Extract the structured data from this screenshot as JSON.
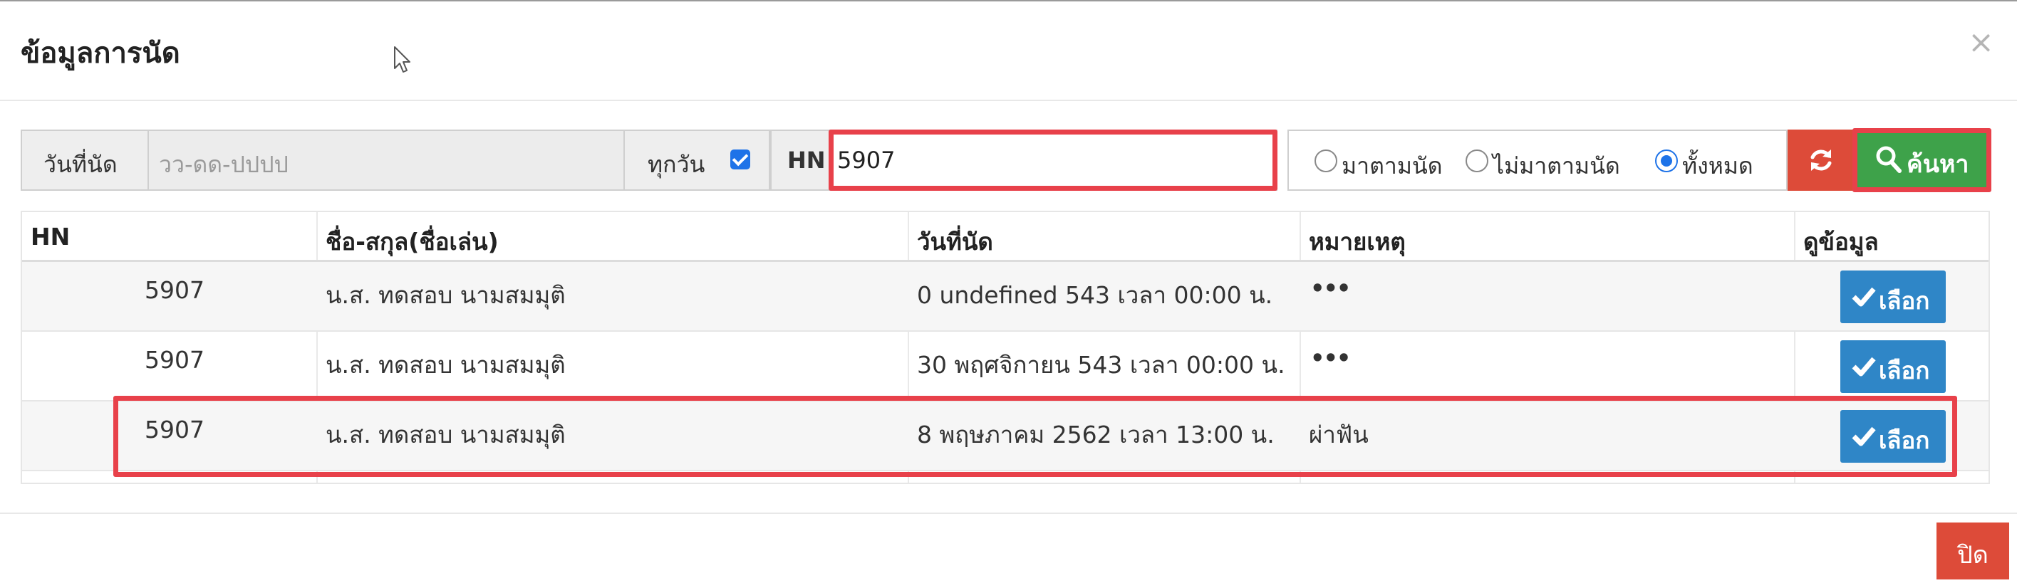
{
  "modal": {
    "title": "ข้อมูลการนัด",
    "close_symbol": "×"
  },
  "search": {
    "date_label": "วันที่นัด",
    "date_placeholder": "วว-ดด-ปปปป",
    "every_day_label": "ทุกวัน",
    "every_day_checked": true,
    "hn_label": "HN",
    "hn_value": "5907",
    "radio_options": [
      {
        "label": "มาตามนัด",
        "selected": false
      },
      {
        "label": "ไม่มาตามนัด",
        "selected": false
      },
      {
        "label": "ทั้งหมด",
        "selected": true
      }
    ],
    "refresh_icon": "refresh-icon",
    "search_button_label": "ค้นหา"
  },
  "table": {
    "headers": [
      "HN",
      "ชื่อ-สกุล(ชื่อเล่น)",
      "วันที่นัด",
      "หมายเหตุ",
      "ดูข้อมูล"
    ],
    "rows": [
      {
        "hn": "5907",
        "name": "น.ส. ทดสอบ นามสมมุติ",
        "date": "0 undefined 543 เวลา 00:00 น.",
        "note": "•••",
        "action": "เลือก"
      },
      {
        "hn": "5907",
        "name": "น.ส. ทดสอบ นามสมมุติ",
        "date": "30 พฤศจิกายน 543 เวลา 00:00 น.",
        "note": "•••",
        "action": "เลือก"
      },
      {
        "hn": "5907",
        "name": "น.ส. ทดสอบ นามสมมุติ",
        "date": "8 พฤษภาคม 2562 เวลา 13:00 น.",
        "note": "ผ่าฟัน",
        "action": "เลือก"
      }
    ]
  },
  "footer": {
    "close_button_label": "ปิด"
  },
  "colors": {
    "highlight_outline": "#e8414a",
    "search_button": "#3ea24a",
    "refresh_button": "#dd4b39",
    "select_button": "#2f86c7",
    "close_button": "#dd4b39",
    "checkbox": "#1e73e8"
  }
}
